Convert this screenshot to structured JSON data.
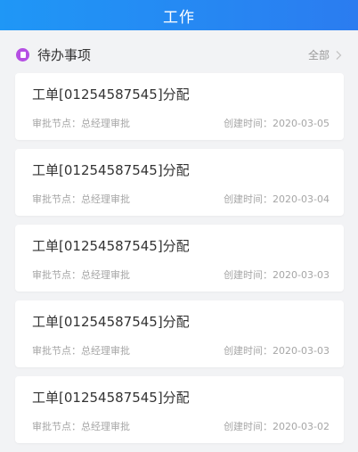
{
  "header": {
    "title": "工作"
  },
  "todo_section": {
    "title": "待办事项",
    "all_label": "全部",
    "icon": "document-icon",
    "icon_color": "#b54fe3"
  },
  "colors": {
    "header_start": "#1f97f6",
    "header_end": "#2b7cf0",
    "background": "#f2f3f5"
  },
  "items": [
    {
      "title": "工单[01254587545]分配",
      "node": "审批节点：总经理审批",
      "time": "创建时间：2020-03-05"
    },
    {
      "title": "工单[01254587545]分配",
      "node": "审批节点：总经理审批",
      "time": "创建时间：2020-03-04"
    },
    {
      "title": "工单[01254587545]分配",
      "node": "审批节点：总经理审批",
      "time": "创建时间：2020-03-03"
    },
    {
      "title": "工单[01254587545]分配",
      "node": "审批节点：总经理审批",
      "time": "创建时间：2020-03-03"
    },
    {
      "title": "工单[01254587545]分配",
      "node": "审批节点：总经理审批",
      "time": "创建时间：2020-03-02"
    }
  ]
}
